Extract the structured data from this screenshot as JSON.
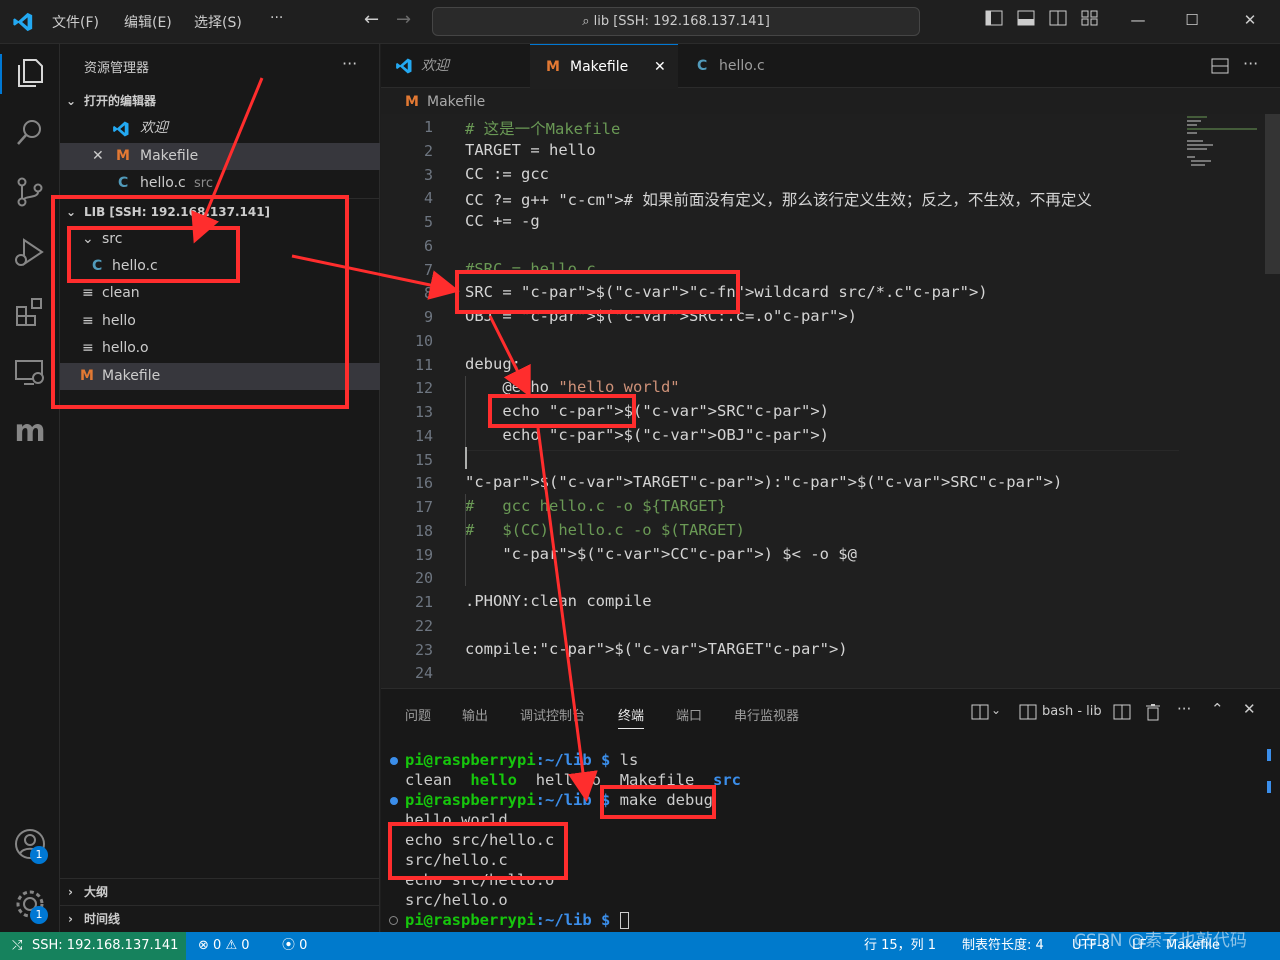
{
  "titlebar": {
    "menus": [
      "文件(F)",
      "编辑(E)",
      "选择(S)",
      "···"
    ],
    "command_center": "lib [SSH: 192.168.137.141]"
  },
  "sidebar": {
    "title": "资源管理器",
    "more": "···",
    "open_editors_header": "打开的编辑器",
    "open_editors": [
      {
        "label": "欢迎",
        "extra": ""
      },
      {
        "label": "Makefile",
        "extra": ""
      },
      {
        "label": "hello.c",
        "extra": "src"
      }
    ],
    "folder_header": "LIB [SSH: 192.168.137.141]",
    "tree": [
      {
        "label": "src",
        "icon": "chevron-down"
      },
      {
        "label": "hello.c",
        "icon": "c-file"
      },
      {
        "label": "clean",
        "icon": "file-lines"
      },
      {
        "label": "hello",
        "icon": "file-lines"
      },
      {
        "label": "hello.o",
        "icon": "file-lines"
      },
      {
        "label": "Makefile",
        "icon": "makefile"
      }
    ],
    "outline": "大纲",
    "timeline": "时间线"
  },
  "tabs": [
    {
      "label": "欢迎"
    },
    {
      "label": "Makefile",
      "close": "✕"
    },
    {
      "label": "hello.c"
    }
  ],
  "breadcrumb": "Makefile",
  "editor": {
    "lines": [
      "# 这是一个Makefile",
      "TARGET = hello",
      "CC := gcc",
      "CC ?= g++ # 如果前面没有定义，那么该行定义生效；反之，不生效，不再定义",
      "CC += -g",
      "",
      "#SRC = hello.c",
      "SRC = $(wildcard src/*.c)",
      "OBJ = $(SRC:.c=.o)",
      "",
      "debug:",
      "    @echo \"hello world\"",
      "    echo $(SRC)",
      "    echo $(OBJ)",
      "",
      "$(TARGET):$(SRC)",
      "#   gcc hello.c -o ${TARGET}",
      "#   $(CC) hello.c -o $(TARGET)",
      "    $(CC) $< -o $@",
      "",
      ".PHONY:clean compile",
      "",
      "compile:$(TARGET)",
      ""
    ]
  },
  "panel": {
    "tabs": [
      "问题",
      "输出",
      "调试控制台",
      "终端",
      "端口",
      "串行监视器"
    ],
    "active_tab": "终端",
    "terminal_name": "bash - lib",
    "prompt_user": "pi@raspberrypi",
    "prompt_path": ":~/lib $",
    "cmd1": "ls",
    "ls_out": [
      "clean",
      "hello",
      "hello.o",
      "Makefile",
      "src"
    ],
    "cmd2": "make debug",
    "out": [
      "hello world",
      "echo src/hello.c",
      "src/hello.c",
      "echo src/hello.o",
      "src/hello.o"
    ]
  },
  "status": {
    "remote": "SSH: 192.168.137.141",
    "errors": "0",
    "warnings": "0",
    "ports": "0",
    "position": "行 15，列 1",
    "tab_size": "制表符长度: 4",
    "encoding": "UTF-8",
    "eol": "LF",
    "language": "Makefile",
    "watermark": "CSDN @索子也敲代码"
  }
}
